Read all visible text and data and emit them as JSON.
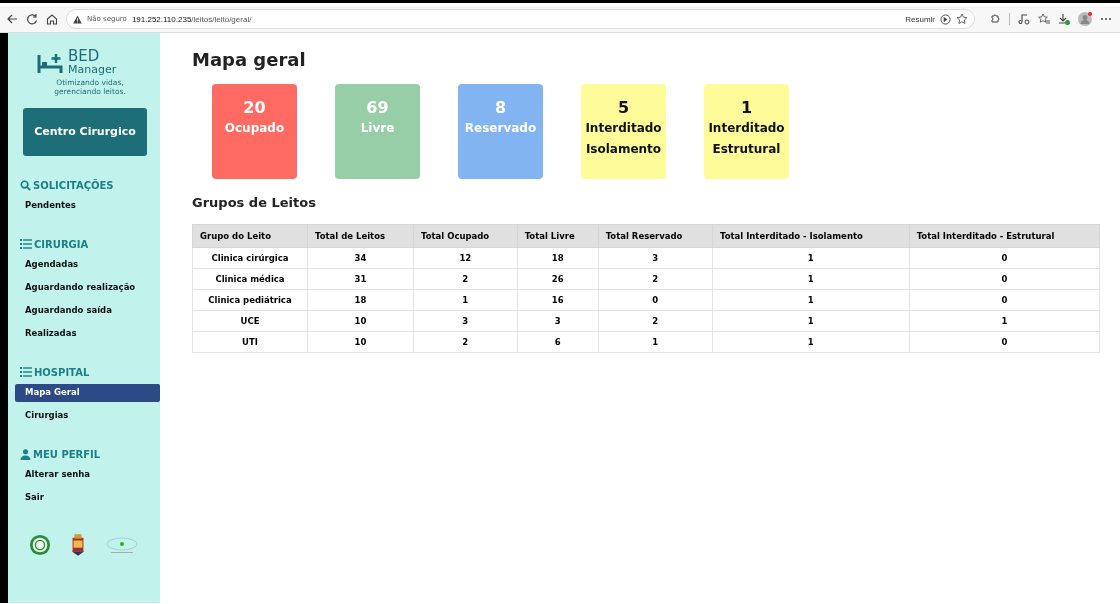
{
  "browser": {
    "security": "Não seguro",
    "url_host": "191.252.110.235",
    "url_path": "/leitos/leito/geral/",
    "summarize": "Resumir"
  },
  "sidebar": {
    "brand_top": "BED",
    "brand_bottom": "Manager",
    "tagline": "Otimizando vidas, gerenciando leitos.",
    "unit_button": "Centro Cirurgico",
    "sections": [
      {
        "kind": "search",
        "title": "SOLICITAÇÕES",
        "items": [
          {
            "label": "Pendentes",
            "selected": false
          }
        ]
      },
      {
        "kind": "list",
        "title": "CIRURGIA",
        "items": [
          {
            "label": "Agendadas",
            "selected": false
          },
          {
            "label": "Aguardando realização",
            "selected": false
          },
          {
            "label": "Aguardando saída",
            "selected": false
          },
          {
            "label": "Realizadas",
            "selected": false
          }
        ]
      },
      {
        "kind": "list",
        "title": "HOSPITAL",
        "items": [
          {
            "label": "Mapa Geral",
            "selected": true
          },
          {
            "label": "Cirurgias",
            "selected": false
          }
        ]
      },
      {
        "kind": "person",
        "title": "MEU PERFIL",
        "items": [
          {
            "label": "Alterar senha",
            "selected": false
          },
          {
            "label": "Sair",
            "selected": false
          }
        ]
      }
    ]
  },
  "page_title": "Mapa geral",
  "summary_cards": [
    {
      "count": "20",
      "label": "Ocupado",
      "color": "#ff6b63"
    },
    {
      "count": "69",
      "label": "Livre",
      "color": "#97cda7"
    },
    {
      "count": "8",
      "label": "Reservado",
      "color": "#82b4f2"
    },
    {
      "count": "5",
      "label": "Interditado Isolamento",
      "color": "#fdfc98"
    },
    {
      "count": "1",
      "label": "Interditado Estrutural",
      "color": "#fdfc98"
    }
  ],
  "table": {
    "title": "Grupos de Leitos",
    "columns": [
      "Grupo do Leito",
      "Total de Leitos",
      "Total Ocupado",
      "Total Livre",
      "Total Reservado",
      "Total Interditado - Isolamento",
      "Total Interditado - Estrutural"
    ],
    "rows": [
      [
        "Clinica cirúrgica",
        "34",
        "12",
        "18",
        "3",
        "1",
        "0"
      ],
      [
        "Clinica médica",
        "31",
        "2",
        "26",
        "2",
        "1",
        "0"
      ],
      [
        "Clinica pediátrica",
        "18",
        "1",
        "16",
        "0",
        "1",
        "0"
      ],
      [
        "UCE",
        "10",
        "3",
        "3",
        "2",
        "1",
        "1"
      ],
      [
        "UTI",
        "10",
        "2",
        "6",
        "1",
        "1",
        "0"
      ]
    ]
  }
}
